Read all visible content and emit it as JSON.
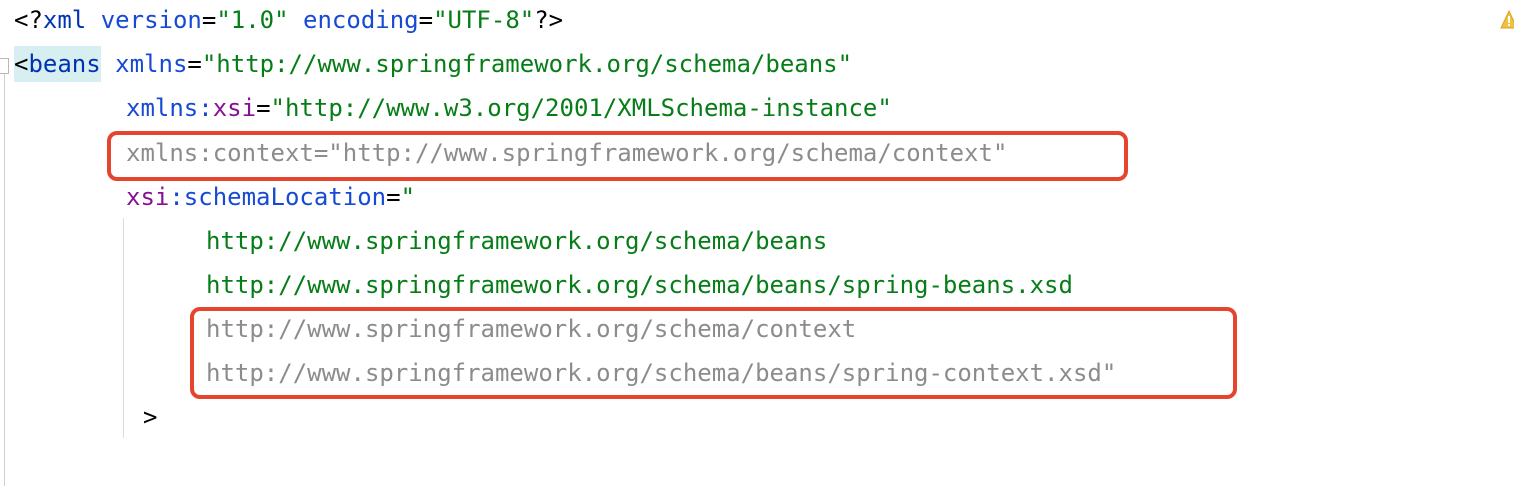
{
  "editor": {
    "lines": {
      "prolog": {
        "open": "<?",
        "name": "xml",
        "attr1": "version",
        "eq1": "=",
        "val1": "\"1.0\"",
        "attr2": "encoding",
        "eq2": "=",
        "val2": "\"UTF-8\"",
        "close": "?>"
      },
      "beans_open": {
        "lt": "<",
        "tag": "beans",
        "attr": "xmlns",
        "eq": "=",
        "val": "\"http://www.springframework.org/schema/beans\""
      },
      "xmlns_xsi": {
        "prefix": "xmlns:",
        "ns": "xsi",
        "eq": "=",
        "val": "\"http://www.w3.org/2001/XMLSchema-instance\""
      },
      "xmlns_context": {
        "text": "xmlns:context=\"http://www.springframework.org/schema/context\""
      },
      "schema_location": {
        "ns": "xsi",
        "colon_attr": ":schemaLocation",
        "eq": "=",
        "quote": "\""
      },
      "loc1": {
        "text": "http://www.springframework.org/schema/beans"
      },
      "loc2": {
        "text": "http://www.springframework.org/schema/beans/spring-beans.xsd"
      },
      "loc3": {
        "text": "http://www.springframework.org/schema/context"
      },
      "loc4": {
        "text": "http://www.springframework.org/schema/beans/spring-context.xsd\""
      },
      "close_gt": {
        "text": ">"
      }
    },
    "colors": {
      "tag": "#0033b3",
      "attribute": "#174ad4",
      "namespace": "#871094",
      "value": "#067d17",
      "unused": "#8c8c8c",
      "highlight": "#e5452e",
      "tag_background": "#d7eff0",
      "warning": "#f0c040"
    },
    "icons": {
      "warning": "warning-icon",
      "fold": "fold-marker-icon"
    }
  }
}
